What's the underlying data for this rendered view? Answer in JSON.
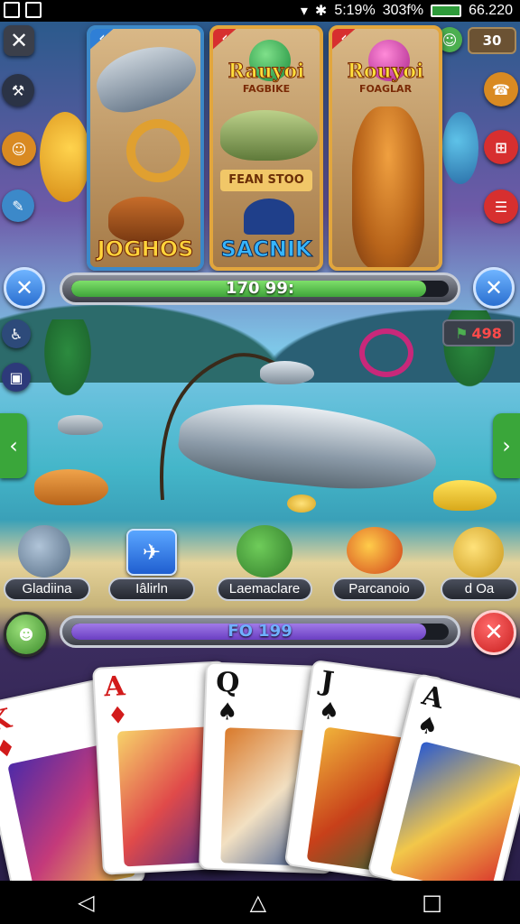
{
  "status_bar": {
    "time": "5:19%",
    "carrier": "303f%",
    "battery": "66.220"
  },
  "header": {
    "counter_value": "30"
  },
  "top_cards": [
    {
      "title": "",
      "subtitle": "",
      "bottom_label": "JOGHOS"
    },
    {
      "title": "Rauyoi",
      "subtitle_top": "FAGBIKE",
      "subtitle": "FEAN STOO",
      "bottom_label": "SACNIK"
    },
    {
      "title": "Rouyoi",
      "subtitle_top": "FOAGLAR",
      "subtitle": "",
      "bottom_label": ""
    }
  ],
  "top_bar": {
    "label": "170 99:",
    "progress": 0.94,
    "color": "#3fa43a"
  },
  "bottom_bar": {
    "label": "FO 199",
    "progress": 0.94,
    "color": "#6a3fc2"
  },
  "score_badge": {
    "value": "498"
  },
  "items": [
    {
      "label": "Gladiina"
    },
    {
      "label": "Iâlirln"
    },
    {
      "label": "Laemaclare"
    },
    {
      "label": "Parcanoio"
    },
    {
      "label": "d Oa"
    }
  ],
  "cards": [
    {
      "rank": "K",
      "suit": "♦",
      "color": "#d21b1b"
    },
    {
      "rank": "A",
      "suit": "♦",
      "color": "#d21b1b"
    },
    {
      "rank": "Q",
      "suit": "♠",
      "color": "#111111"
    },
    {
      "rank": "J",
      "suit": "♠",
      "color": "#111111"
    },
    {
      "rank": "A",
      "suit": "♠",
      "color": "#111111"
    }
  ],
  "nav": {
    "back": "◁",
    "home": "△",
    "recents": "□"
  },
  "colors": {
    "accent_red": "#d72f2f",
    "accent_blue": "#2f7fd6",
    "gold": "#e2a63d"
  }
}
